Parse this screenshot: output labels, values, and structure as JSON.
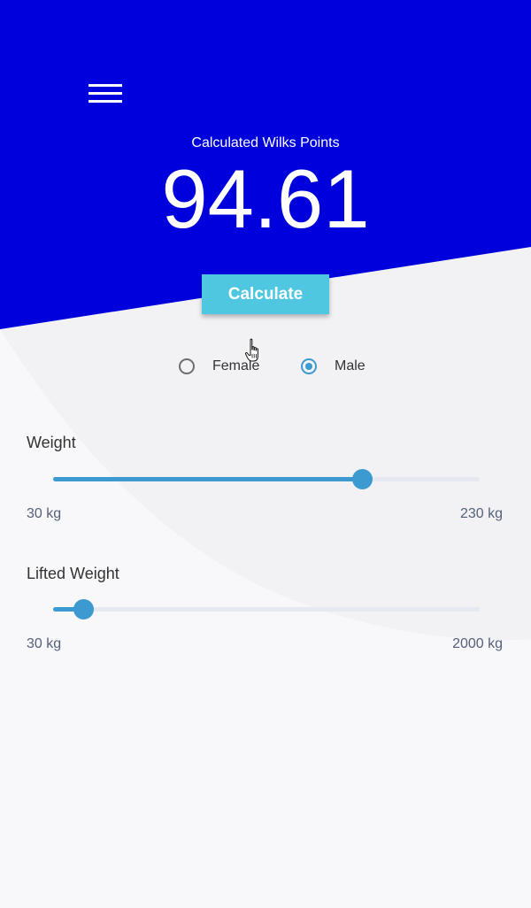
{
  "header": {
    "result_label": "Calculated Wilks Points",
    "result_value": "94.61",
    "calculate_label": "Calculate"
  },
  "gender": {
    "options": [
      {
        "label": "Female",
        "selected": false
      },
      {
        "label": "Male",
        "selected": true
      }
    ]
  },
  "sliders": [
    {
      "label": "Weight",
      "min_label": "30 kg",
      "max_label": "230 kg",
      "fill_fraction": 0.725
    },
    {
      "label": "Lifted Weight",
      "min_label": "30 kg",
      "max_label": "2000 kg",
      "fill_fraction": 0.07
    }
  ],
  "colors": {
    "header_bg": "#0000dc",
    "accent": "#3d9ad0",
    "button_bg": "#4fc7e0",
    "page_bg": "#f8f7f9"
  },
  "icons": {
    "menu": "hamburger-menu-icon",
    "cursor": "hand-pointer-icon"
  }
}
